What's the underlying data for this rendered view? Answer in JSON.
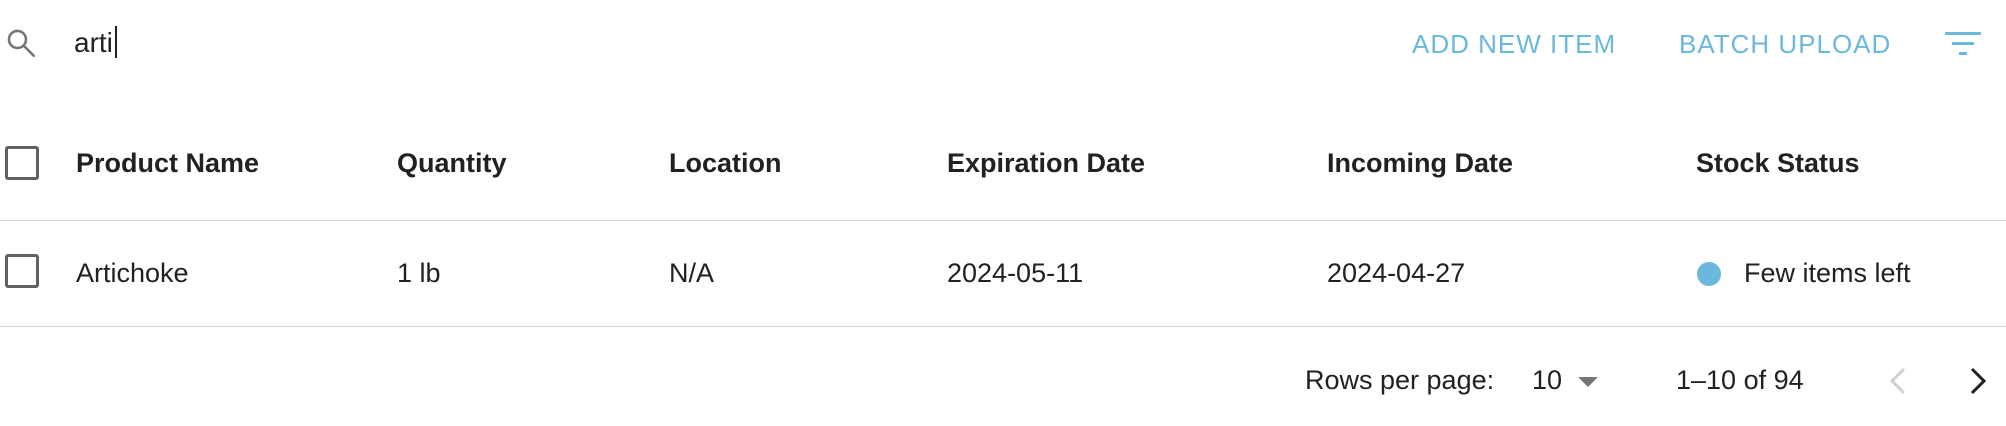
{
  "toolbar": {
    "search_value": "arti",
    "add_label": "ADD NEW ITEM",
    "batch_label": "BATCH UPLOAD",
    "search_icon": "search-icon",
    "filter_icon": "filter-icon",
    "accent_color": "#6bb8dd"
  },
  "table": {
    "columns": [
      "Product Name",
      "Quantity",
      "Location",
      "Expiration Date",
      "Incoming Date",
      "Stock Status"
    ],
    "rows": [
      {
        "name": "Artichoke",
        "quantity": "1 lb",
        "location": "N/A",
        "expiration": "2024-05-11",
        "incoming": "2024-04-27",
        "status": "Few items left",
        "status_color": "#6bb8dd"
      }
    ]
  },
  "pagination": {
    "rows_label": "Rows per page:",
    "rows_value": "10",
    "range": "1–10 of 94"
  }
}
